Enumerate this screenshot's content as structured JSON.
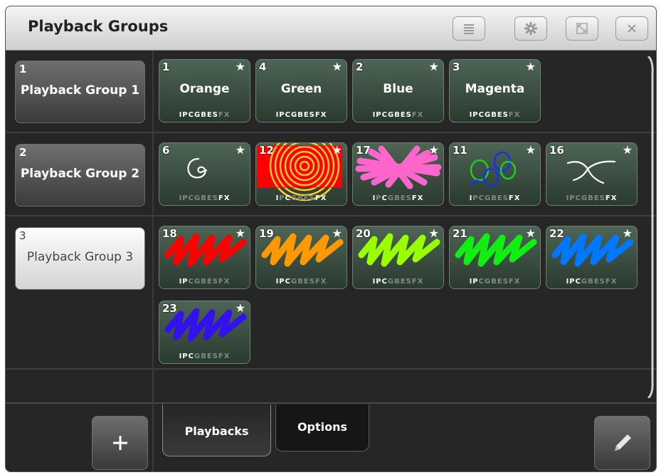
{
  "window": {
    "title": "Playback Groups"
  },
  "toolbar": {
    "menu_icon": "menu-icon",
    "settings_icon": "gear-icon",
    "resize_icon": "resize-icon",
    "close_icon": "close-icon"
  },
  "groups": [
    {
      "number": "1",
      "label": "Playback Group 1",
      "selected": false
    },
    {
      "number": "2",
      "label": "Playback Group 2",
      "selected": false
    },
    {
      "number": "3",
      "label": "Playback Group 3",
      "selected": true
    }
  ],
  "attr_letters": [
    "I",
    "P",
    "C",
    "G",
    "B",
    "E",
    "S",
    "FX"
  ],
  "rows": [
    {
      "tiles": [
        {
          "number": "1",
          "name": "Orange",
          "art": "",
          "active": [
            1,
            1,
            1,
            1,
            1,
            1,
            1,
            0
          ]
        },
        {
          "number": "4",
          "name": "Green",
          "art": "",
          "active": [
            1,
            1,
            1,
            1,
            1,
            1,
            1,
            1
          ]
        },
        {
          "number": "2",
          "name": "Blue",
          "art": "",
          "active": [
            1,
            1,
            1,
            1,
            1,
            1,
            1,
            0
          ]
        },
        {
          "number": "3",
          "name": "Magenta",
          "art": "",
          "active": [
            1,
            1,
            1,
            1,
            1,
            1,
            1,
            0
          ]
        }
      ]
    },
    {
      "tiles": [
        {
          "number": "6",
          "name": "",
          "art": "spiral-white",
          "active": [
            0,
            0,
            0,
            0,
            0,
            0,
            0,
            1
          ]
        },
        {
          "number": "12",
          "name": "",
          "art": "spiral-red",
          "active": [
            1,
            0,
            1,
            0,
            0,
            0,
            0,
            1
          ]
        },
        {
          "number": "17",
          "name": "",
          "art": "pink-burst",
          "active": [
            1,
            0,
            1,
            0,
            0,
            0,
            0,
            1
          ]
        },
        {
          "number": "11",
          "name": "",
          "art": "circles",
          "active": [
            1,
            0,
            0,
            0,
            0,
            0,
            0,
            1
          ]
        },
        {
          "number": "16",
          "name": "",
          "art": "swirl",
          "active": [
            0,
            0,
            0,
            0,
            0,
            0,
            0,
            1
          ]
        }
      ]
    },
    {
      "tiles": [
        {
          "number": "18",
          "name": "",
          "art": "scribble-red",
          "active": [
            1,
            1,
            0,
            0,
            0,
            0,
            0,
            0
          ]
        },
        {
          "number": "19",
          "name": "",
          "art": "scribble-orange",
          "active": [
            1,
            1,
            1,
            0,
            0,
            0,
            0,
            0
          ]
        },
        {
          "number": "20",
          "name": "",
          "art": "scribble-lime",
          "active": [
            1,
            1,
            1,
            0,
            0,
            0,
            0,
            0
          ]
        },
        {
          "number": "21",
          "name": "",
          "art": "scribble-green",
          "active": [
            1,
            1,
            0,
            0,
            0,
            0,
            0,
            0
          ]
        },
        {
          "number": "22",
          "name": "",
          "art": "scribble-blue",
          "active": [
            1,
            1,
            1,
            0,
            0,
            0,
            0,
            0
          ]
        }
      ]
    },
    {
      "tiles": [
        {
          "number": "23",
          "name": "",
          "art": "scribble-purple",
          "active": [
            1,
            1,
            1,
            0,
            0,
            0,
            0,
            0
          ]
        }
      ]
    }
  ],
  "tabs": {
    "playbacks": "Playbacks",
    "options": "Options"
  },
  "buttons": {
    "add_icon": "plus-icon",
    "edit_icon": "pencil-icon"
  }
}
